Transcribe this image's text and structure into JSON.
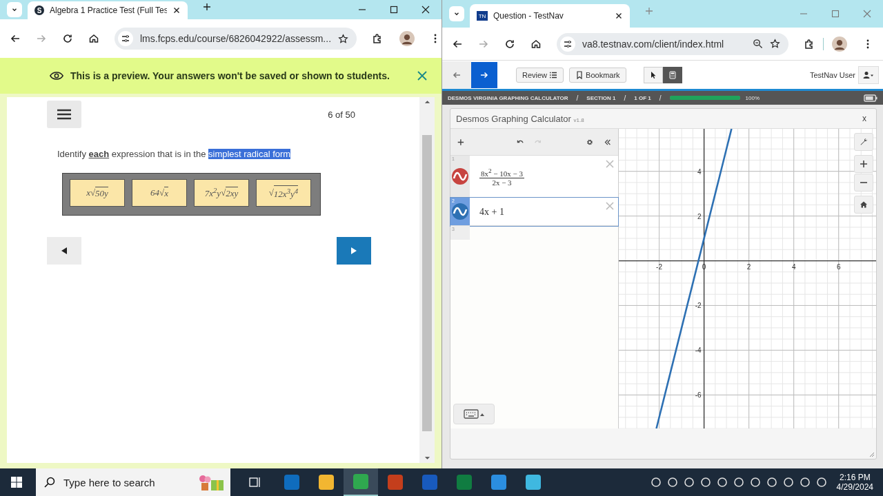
{
  "left_window": {
    "tab": {
      "favicon_text": "S",
      "title": "Algebra 1 Practice Test (Full Tes",
      "selected": true
    },
    "address": {
      "url": "lms.fcps.edu/course/6826042922/assessm..."
    },
    "banner": {
      "text": "This is a preview. Your answers won't be saved or shown to students."
    },
    "question": {
      "counter": "6 of 50",
      "prompt": "Identify **each** expression that is in the",
      "selected_text": "simplest radical form",
      "choices": [
        {
          "coefficient": "x",
          "radical": "√",
          "radicand": "50y"
        },
        {
          "coefficient": "64",
          "radical": "√",
          "radicand": "x"
        },
        {
          "coefficient": "7x$^{2}$y",
          "radical": "√",
          "radicand": "2xy"
        },
        {
          "radical": "√",
          "radicand": "12x$^{3}$y$^{4}$"
        }
      ]
    }
  },
  "right_window": {
    "tab": {
      "favicon_text": "TN",
      "title": "Question - TestNav",
      "selected": true
    },
    "address": {
      "url": "va8.testnav.com/client/index.html"
    },
    "toolbar": {
      "review": "Review",
      "bookmark": "Bookmark",
      "tools": [
        {
          "kind": "pointer",
          "selected": false
        },
        {
          "kind": "calculator",
          "selected": true
        }
      ],
      "user": "TestNav User"
    },
    "breadcrumb": {
      "items": [
        "DESMOS VIRGINIA GRAPHING CALCULATOR",
        "SECTION 1",
        "1 OF 1"
      ],
      "separator": "/",
      "level": 1.0,
      "percent": "100%"
    },
    "calculator": {
      "title": "Desmos Graphing Calculator",
      "version": "v1.8",
      "close": "x",
      "expressions": [
        {
          "number": "1",
          "kind": "fraction",
          "color": "#c74440",
          "numerator": "8x$^{2}$ − 10x − 3",
          "denominator": "2x − 3",
          "selected": false
        },
        {
          "number": "2",
          "kind": "plain",
          "color": "#2d70b3",
          "text": "4x + 1",
          "selected": true
        }
      ],
      "empty_row": "3",
      "graph": {
        "chart_data": {
          "type": "line",
          "x": [
            -2.125,
            1.225
          ],
          "series": [
            {
              "color": "#2d70b3",
              "values": [
                -7.5,
                5.9
              ]
            }
          ],
          "grid": true,
          "xlim": [
            -3.8,
            7.7
          ],
          "ylim": [
            -7.5,
            5.9
          ],
          "xticks": [
            -2,
            0,
            2,
            4,
            6
          ],
          "yticks": [
            -6,
            -4,
            -2,
            2,
            4
          ]
        }
      }
    }
  },
  "taskbar": {
    "search_placeholder": "Type here to search",
    "apps": [
      {
        "color": "#0f6cbd",
        "selected": false
      },
      {
        "color": "#f2b631",
        "selected": false
      },
      {
        "color": "#2fa84f",
        "selected": true
      },
      {
        "color": "#c43e1c",
        "selected": false
      },
      {
        "color": "#185abd",
        "selected": false
      },
      {
        "color": "#107c41",
        "selected": false
      },
      {
        "color": "#2b8ee0",
        "selected": false
      },
      {
        "color": "#3fb8e0",
        "selected": false
      }
    ],
    "time": "2:16 PM",
    "date": "4/29/2024"
  }
}
